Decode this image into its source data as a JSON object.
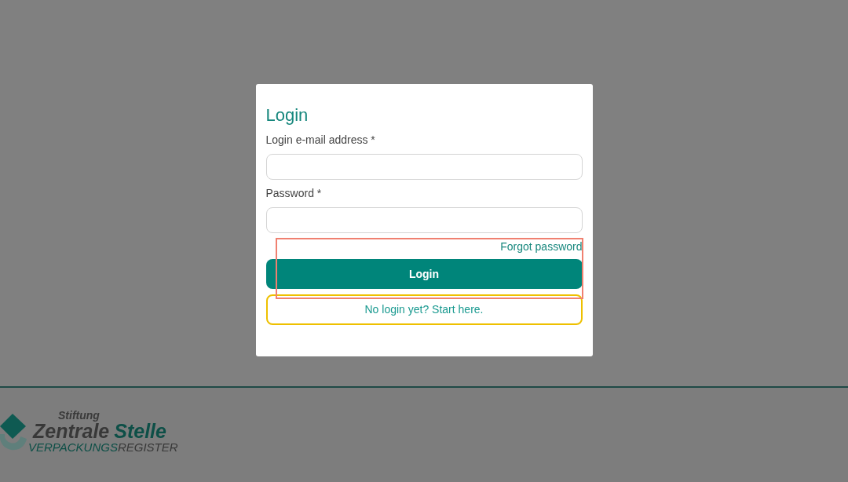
{
  "login_card": {
    "title": "Login",
    "fields": [
      {
        "label": "Login e-mail address *"
      },
      {
        "label": "Password *"
      }
    ],
    "forgot_link": "Forgot password",
    "login_button": "Login",
    "register_button": "No login yet? Start here."
  },
  "footer": {
    "logo": {
      "top": "Stiftung",
      "name_first": "Zentrale",
      "name_second": "Stelle",
      "sub_first": "VERPACKUNGS",
      "sub_second": "REGISTER"
    }
  }
}
